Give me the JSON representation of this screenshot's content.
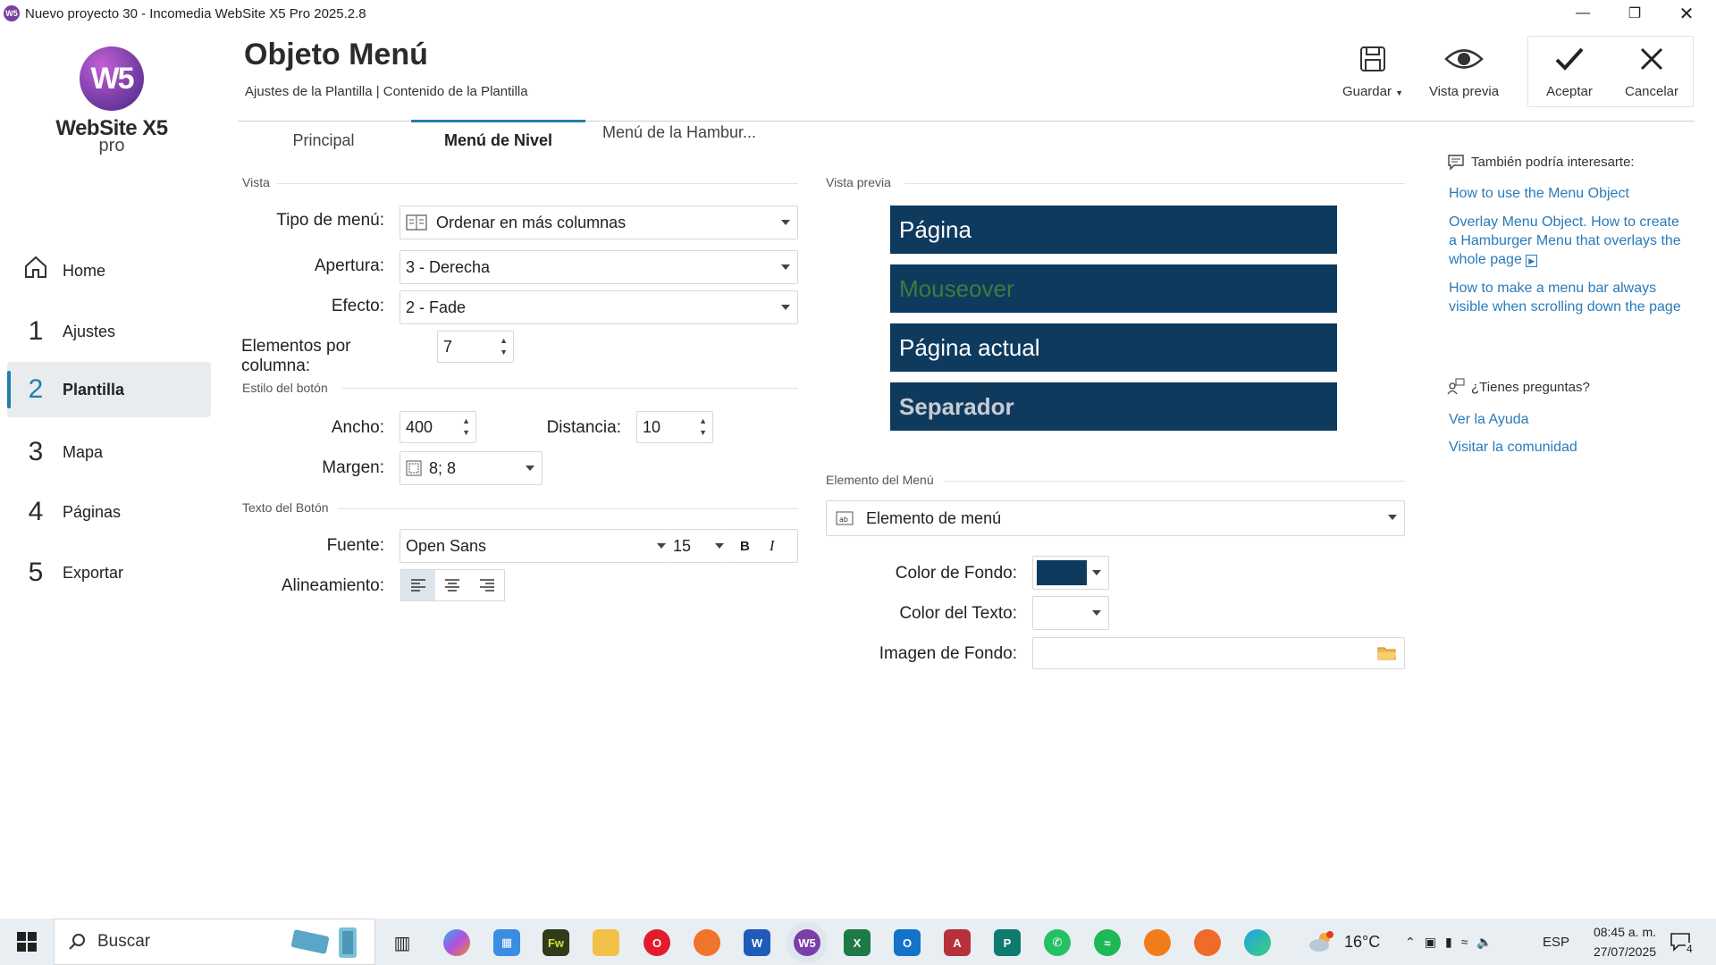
{
  "window": {
    "title": "Nuevo proyecto 30 - Incomedia WebSite X5 Pro 2025.2.8"
  },
  "logo": {
    "word": "WebSite X5",
    "pro": "pro",
    "mark": "W5"
  },
  "sidebar": {
    "items": [
      {
        "num": "",
        "label": "Home"
      },
      {
        "num": "1",
        "label": "Ajustes"
      },
      {
        "num": "2",
        "label": "Plantilla"
      },
      {
        "num": "3",
        "label": "Mapa"
      },
      {
        "num": "4",
        "label": "Páginas"
      },
      {
        "num": "5",
        "label": "Exportar"
      }
    ]
  },
  "header": {
    "title": "Objeto Menú",
    "breadcrumb": "Ajustes de la Plantilla | Contenido de la Plantilla"
  },
  "toolbar": {
    "save": "Guardar",
    "preview": "Vista previa",
    "accept": "Aceptar",
    "cancel": "Cancelar"
  },
  "tabs": [
    "Principal",
    "Menú de Nivel",
    "Menú de la Hambur..."
  ],
  "vista": {
    "section": "Vista",
    "tipo_label": "Tipo de menú:",
    "tipo_value": "Ordenar en más columnas",
    "apertura_label": "Apertura:",
    "apertura_value": "3 - Derecha",
    "efecto_label": "Efecto:",
    "efecto_value": "2 - Fade",
    "elementos_label": "Elementos por columna:",
    "elementos_value": "7"
  },
  "estilo": {
    "section": "Estilo del botón",
    "ancho_label": "Ancho:",
    "ancho_value": "400",
    "distancia_label": "Distancia:",
    "distancia_value": "10",
    "margen_label": "Margen:",
    "margen_value": "8; 8"
  },
  "texto": {
    "section": "Texto del Botón",
    "fuente_label": "Fuente:",
    "fuente_value": "Open Sans",
    "size_value": "15",
    "bold": "B",
    "italic": "I",
    "alineamiento_label": "Alineamiento:"
  },
  "preview": {
    "section": "Vista previa",
    "items": [
      "Página",
      "Mouseover",
      "Página actual",
      "Separador"
    ],
    "bg_color": "#0e3a5e",
    "mouseover_color": "#3c7d3c",
    "separator_color": "#c8ccd2"
  },
  "elemento": {
    "section": "Elemento del Menú",
    "select_value": "Elemento de menú",
    "color_fondo_label": "Color de Fondo:",
    "color_fondo_value": "#0e3a5e",
    "color_texto_label": "Color del Texto:",
    "imagen_label": "Imagen de Fondo:"
  },
  "help": {
    "interest_title": "También podría interesarte:",
    "links": [
      "How to use the Menu Object",
      "Overlay Menu Object. How to create a Hamburger Menu that overlays the whole page",
      "How to make a menu bar always visible when scrolling down the page"
    ],
    "questions_title": "¿Tienes preguntas?",
    "q_links": [
      "Ver la Ayuda",
      "Visitar la comunidad"
    ]
  },
  "taskbar": {
    "search": "Buscar",
    "temp": "16°C",
    "lang": "ESP",
    "time": "08:45 a. m.",
    "date": "27/07/2025",
    "notif": "4",
    "apps": [
      "task-view",
      "copilot",
      "store",
      "fireworks",
      "explorer",
      "opera",
      "firefox",
      "word",
      "websitex5",
      "excel",
      "outlook",
      "access",
      "publisher",
      "whatsapp",
      "spotify",
      "clock",
      "app-orange",
      "edge"
    ]
  }
}
